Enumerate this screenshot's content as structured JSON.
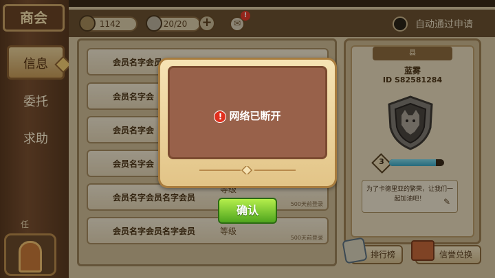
{
  "sidebar": {
    "banner": "商会",
    "tabs": [
      {
        "label": "信息"
      },
      {
        "label": "委托"
      },
      {
        "label": "求助"
      }
    ],
    "bottom_label": "任"
  },
  "topbar": {
    "coins": "1142",
    "members": "20/20",
    "mail_badge": "!",
    "auto_approve_label": "自动通过申请"
  },
  "member_list": [
    {
      "name": "会员名字会员",
      "level": "",
      "login": ""
    },
    {
      "name": "会员名字会",
      "level": "",
      "login": ""
    },
    {
      "name": "会员名字会",
      "level": "",
      "login": ""
    },
    {
      "name": "会员名字会",
      "level": "",
      "login": ""
    },
    {
      "name": "会员名字会员名字会员",
      "level": "等级",
      "login": "500天前登录"
    },
    {
      "name": "会员名字会员名字会员",
      "level": "等级",
      "login": "500天前登录"
    }
  ],
  "guild_info": {
    "ribbon_title": "县",
    "leader": "蓝雾",
    "id": "ID  S82581284",
    "level": "3",
    "exp_fraction": 0.85,
    "notice": "为了卡德里亚的繁荣，让我们一起加油吧！",
    "emblem_icon": "wolf-shield-icon"
  },
  "buttons": {
    "rank": "排行榜",
    "exchange": "信誉兑换"
  },
  "modal": {
    "message": "网络已断开",
    "alert_glyph": "!",
    "confirm": "确认"
  },
  "colors": {
    "confirm_green": "#6cc52a",
    "modal_brown": "#98614a",
    "alert_red": "#e0301e"
  }
}
